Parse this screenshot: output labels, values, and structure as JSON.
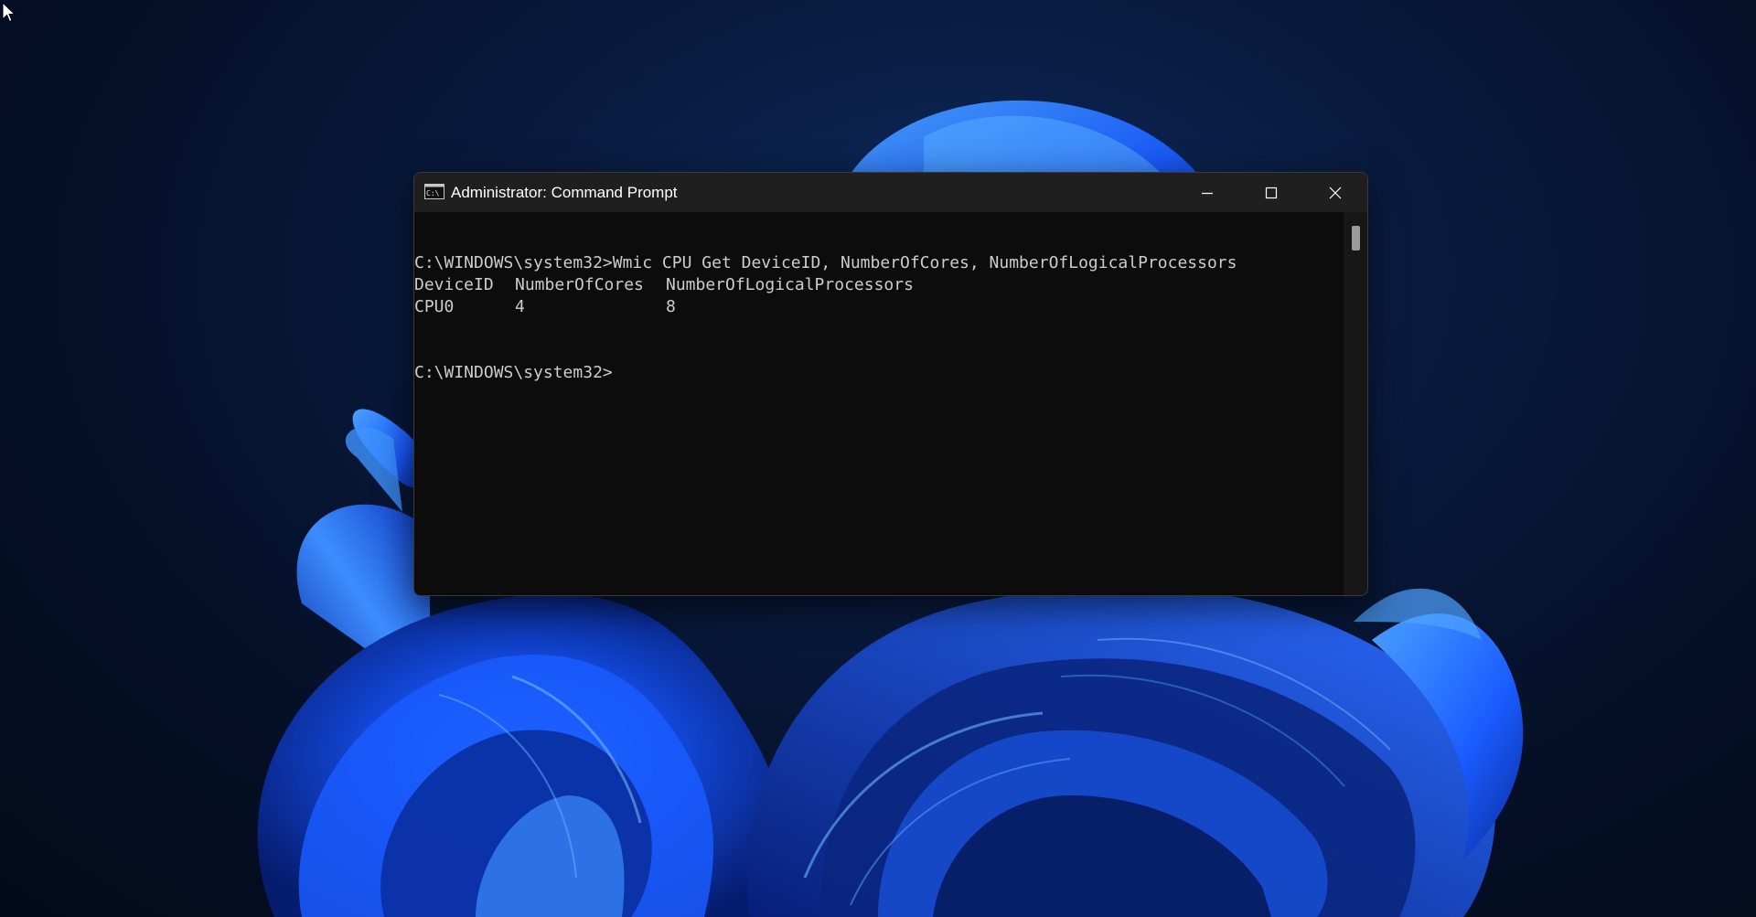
{
  "window": {
    "title": "Administrator: Command Prompt",
    "minimize_icon": "minimize-icon",
    "maximize_icon": "maximize-icon",
    "close_icon": "close-icon",
    "app_icon": "cmd-icon"
  },
  "console": {
    "command_line": "C:\\WINDOWS\\system32>Wmic CPU Get DeviceID, NumberOfCores, NumberOfLogicalProcessors",
    "headers": [
      "DeviceID",
      "NumberOfCores",
      "NumberOfLogicalProcessors"
    ],
    "rows": [
      [
        "CPU0",
        "4",
        "8"
      ]
    ],
    "prompt": "C:\\WINDOWS\\system32>"
  },
  "colors": {
    "console_background": "#0c0c0c",
    "console_text": "#cccccc",
    "titlebar": "#1f1f1f",
    "desktop_accent": "#1a5cff"
  }
}
